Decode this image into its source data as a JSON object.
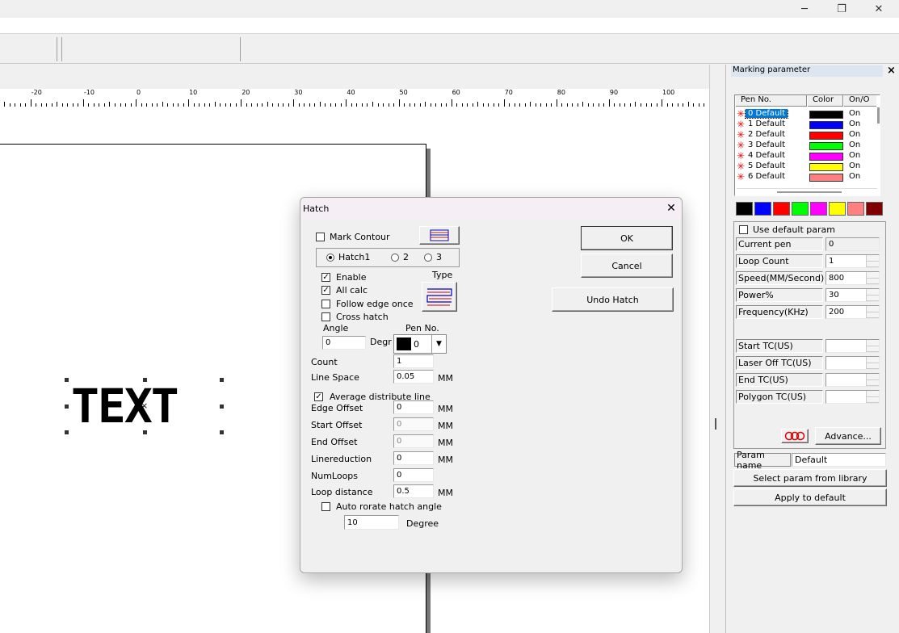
{
  "window": {
    "minimize": "─",
    "restore": "❐",
    "close": "✕"
  },
  "ruler": {
    "labels": [
      "-20",
      "-10",
      "0",
      "10",
      "20",
      "30",
      "40",
      "50",
      "60",
      "70",
      "80",
      "90",
      "100"
    ]
  },
  "canvas": {
    "text": "TEXT"
  },
  "hatch": {
    "title": "Hatch",
    "mark_contour": "Mark Contour",
    "hatch1": "Hatch1",
    "hatch2": "2",
    "hatch3": "3",
    "enable": "Enable",
    "all_calc": "All calc",
    "follow_edge": "Follow edge once",
    "cross_hatch": "Cross hatch",
    "type_label": "Type",
    "angle_label": "Angle",
    "angle_value": "0",
    "degr": "Degr",
    "pen_label": "Pen No.",
    "pen_value": "0",
    "count_label": "Count",
    "count_value": "1",
    "line_space_label": "Line Space",
    "line_space_value": "0.05",
    "avg_line": "Average distribute line",
    "edge_offset_label": "Edge Offset",
    "edge_offset_value": "0",
    "start_offset_label": "Start Offset",
    "start_offset_value": "0",
    "end_offset_label": "End Offset",
    "end_offset_value": "0",
    "linereduction_label": "Linereduction",
    "linereduction_value": "0",
    "numloops_label": "NumLoops",
    "numloops_value": "0",
    "loop_distance_label": "Loop distance",
    "loop_distance_value": "0.5",
    "auto_rotate": "Auto rorate hatch angle",
    "auto_rotate_value": "10",
    "degree": "Degree",
    "mm": "MM",
    "ok": "OK",
    "cancel": "Cancel",
    "undo": "Undo Hatch"
  },
  "panel": {
    "title": "Marking parameter",
    "close": "×",
    "headers": {
      "pen": "Pen No.",
      "color": "Color",
      "onoff": "On/O"
    },
    "pens": [
      {
        "label": "0 Default",
        "color": "#000000",
        "state": "On"
      },
      {
        "label": "1 Default",
        "color": "#0000ff",
        "state": "On"
      },
      {
        "label": "2 Default",
        "color": "#ff0000",
        "state": "On"
      },
      {
        "label": "3 Default",
        "color": "#00ff00",
        "state": "On"
      },
      {
        "label": "4 Default",
        "color": "#ff00ff",
        "state": "On"
      },
      {
        "label": "5 Default",
        "color": "#ffff00",
        "state": "On"
      },
      {
        "label": "6 Default",
        "color": "#ff8080",
        "state": "On"
      }
    ],
    "swatches": [
      "#000000",
      "#0000ff",
      "#ff0000",
      "#00ff00",
      "#ff00ff",
      "#ffff00",
      "#ff8080",
      "#800000"
    ],
    "use_default": "Use default param",
    "current_pen_label": "Current pen",
    "current_pen_value": "0",
    "loop_count_label": "Loop Count",
    "loop_count_value": "1",
    "speed_label": "Speed(MM/Second)",
    "speed_value": "800",
    "power_label": "Power%",
    "power_value": "30",
    "freq_label": "Frequency(KHz)",
    "freq_value": "200",
    "start_tc_label": "Start TC(US)",
    "laser_off_label": "Laser Off TC(US)",
    "end_tc_label": "End TC(US)",
    "polygon_tc_label": "Polygon TC(US)",
    "advance": "Advance...",
    "param_name_label": "Param name",
    "param_name_value": "Default",
    "select_lib": "Select param from library",
    "apply_default": "Apply to default"
  }
}
